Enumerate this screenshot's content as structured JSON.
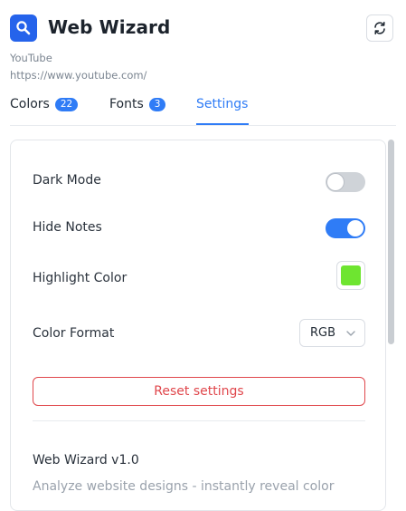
{
  "header": {
    "title": "Web Wizard",
    "logo_icon": "search-icon",
    "refresh_icon": "refresh-icon",
    "brand_color": "#2563eb"
  },
  "site": {
    "name": "YouTube",
    "url": "https://www.youtube.com/"
  },
  "tabs": [
    {
      "label": "Colors",
      "badge": "22",
      "active": false
    },
    {
      "label": "Fonts",
      "badge": "3",
      "active": false
    },
    {
      "label": "Settings",
      "badge": null,
      "active": true
    }
  ],
  "settings": {
    "dark_mode": {
      "label": "Dark Mode",
      "enabled": false
    },
    "hide_notes": {
      "label": "Hide Notes",
      "enabled": true
    },
    "highlight_color": {
      "label": "Highlight Color",
      "value": "#6ee530"
    },
    "color_format": {
      "label": "Color Format",
      "value": "RGB"
    },
    "reset_label": "Reset settings"
  },
  "about": {
    "version": "Web Wizard v1.0",
    "description": "Analyze website designs - instantly reveal color"
  },
  "colors": {
    "accent": "#2f7cf6",
    "danger": "#e0474c"
  }
}
